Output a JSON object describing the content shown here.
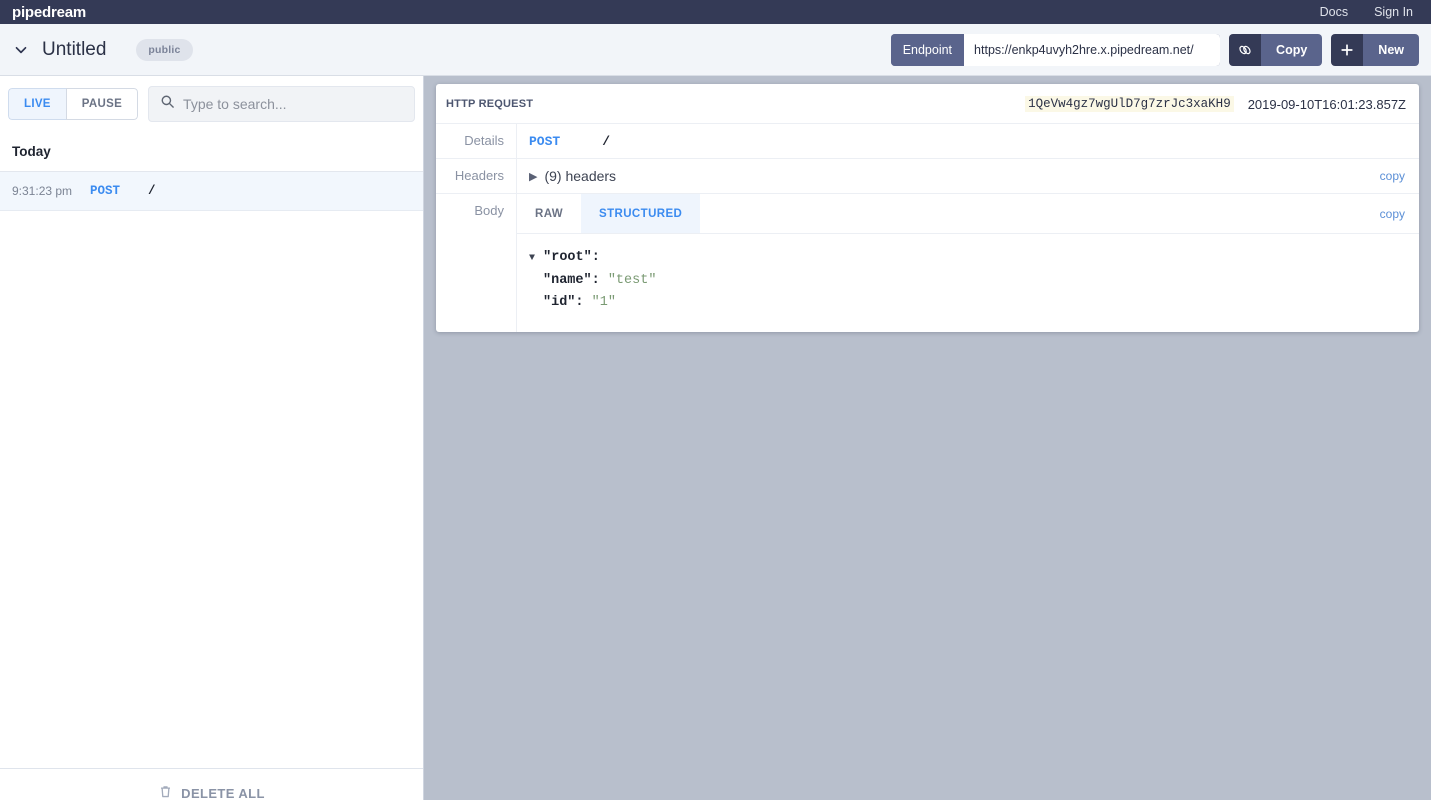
{
  "topnav": {
    "brand": "pipedream",
    "docs_label": "Docs",
    "signin_label": "Sign In"
  },
  "subheader": {
    "chevron_icon": "chevron-down-icon",
    "workflow_title": "Untitled",
    "visibility_badge": "public",
    "endpoint_label": "Endpoint",
    "endpoint_value": "https://enkp4uvyh2hre.x.pipedream.net/",
    "copy_button": {
      "icon": "link-icon",
      "label": "Copy"
    },
    "new_button": {
      "icon": "plus-icon",
      "label": "New"
    }
  },
  "sidebar": {
    "live_label": "LIVE",
    "pause_label": "PAUSE",
    "search_placeholder": "Type to search...",
    "search_value": "",
    "search_icon": "search-icon",
    "day_header": "Today",
    "requests": [
      {
        "time": "9:31:23 pm",
        "method": "POST",
        "path": "/"
      }
    ],
    "delete_all_label": "DELETE ALL",
    "trash_icon": "trash-icon"
  },
  "event": {
    "card_title": "HTTP REQUEST",
    "event_id": "1QeVw4gz7wgUlD7g7zrJc3xaKH9",
    "timestamp": "2019-09-10T16:01:23.857Z",
    "details": {
      "label": "Details",
      "method": "POST",
      "path": "/"
    },
    "headers": {
      "label": "Headers",
      "disclosure_icon": "triangle-right-icon",
      "summary": "(9) headers",
      "copy_label": "copy"
    },
    "body": {
      "label": "Body",
      "tabs": [
        {
          "label": "RAW",
          "active": false
        },
        {
          "label": "STRUCTURED",
          "active": true
        }
      ],
      "copy_label": "copy",
      "json": {
        "root_caret": "▼",
        "root_key": "\"root\":",
        "entries": [
          {
            "key": "\"name\":",
            "value": "\"test\""
          },
          {
            "key": "\"id\":",
            "value": "\"1\""
          }
        ]
      }
    }
  },
  "colors": {
    "navy": "#343a56",
    "slate": "#5a648c",
    "accent_blue": "#3b8bf0",
    "page_bg": "#b8bfcc",
    "highlight": "#fbf8e6"
  }
}
